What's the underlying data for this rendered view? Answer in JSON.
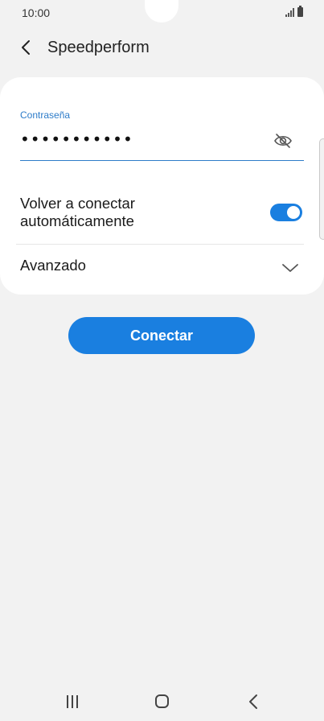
{
  "status_bar": {
    "time": "10:00",
    "icons": [
      "signal-icon",
      "battery-icon"
    ]
  },
  "header": {
    "back_icon": "back-arrow-icon",
    "title": "Speedperform"
  },
  "form": {
    "password_label": "Contraseña",
    "password_value": "•••••••••••",
    "visibility_icon": "eye-off-icon",
    "auto_reconnect_label": "Volver a conectar automáticamente",
    "auto_reconnect_on": true,
    "advanced_label": "Avanzado",
    "advanced_icon": "chevron-down-icon"
  },
  "connect_button": {
    "label": "Conectar"
  },
  "nav_bar": {
    "icons": [
      "recent-apps-icon",
      "home-icon",
      "back-icon"
    ]
  },
  "colors": {
    "accent": "#1a7fe0",
    "label_blue": "#2d7cc9",
    "background": "#f2f2f2",
    "card": "#ffffff"
  }
}
